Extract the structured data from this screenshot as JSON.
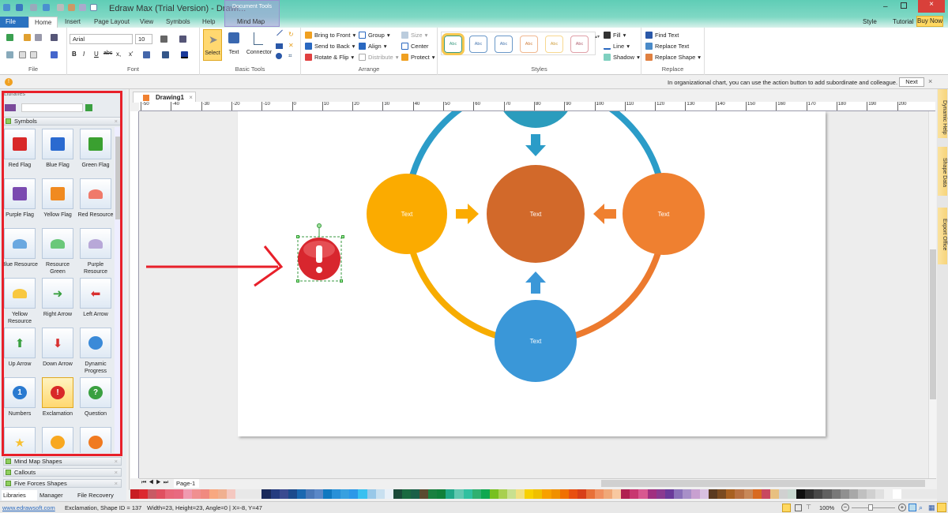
{
  "app": {
    "title": "Edraw Max (Trial Version) - Drawi...",
    "context_tab_group": "Document Tools",
    "buy_now": "Buy Now",
    "style": "Style",
    "tutorial": "Tutorial"
  },
  "tabs": [
    "File",
    "Home",
    "Insert",
    "Page Layout",
    "View",
    "Symbols",
    "Help",
    "Mind Map"
  ],
  "ribbon": {
    "file_group": "File",
    "font": {
      "group": "Font",
      "family": "Arial",
      "size": "10",
      "bold": "B",
      "italic": "I",
      "underline": "U",
      "strike": "abc",
      "sub": "x,",
      "sup": "x'"
    },
    "basic_tools": {
      "group": "Basic Tools",
      "select": "Select",
      "text": "Text",
      "connector": "Connector"
    },
    "arrange": {
      "group": "Arrange",
      "bring_front": "Bring to Front",
      "send_back": "Send to Back",
      "rotate_flip": "Rotate & Flip",
      "group_btn": "Group",
      "align": "Align",
      "distribute": "Distribute",
      "size": "Size",
      "center": "Center",
      "protect": "Protect"
    },
    "styles": {
      "group": "Styles",
      "swatch": "Abc",
      "fill": "Fill",
      "line": "Line",
      "shadow": "Shadow"
    },
    "replace": {
      "group": "Replace",
      "find": "Find Text",
      "replace_text": "Replace Text",
      "replace_shape": "Replace Shape"
    }
  },
  "infobar": {
    "message": "In organizational chart, you can use the action button to add subordinate and colleague.",
    "next": "Next"
  },
  "library": {
    "title": "Libraries",
    "sections": [
      "Symbols",
      "Mind Map Shapes",
      "Callouts",
      "Five Forces Shapes"
    ],
    "shapes": [
      {
        "label": "Red Flag",
        "icon": "red-flag"
      },
      {
        "label": "Blue Flag",
        "icon": "blue-flag"
      },
      {
        "label": "Green Flag",
        "icon": "green-flag"
      },
      {
        "label": "Purple Flag",
        "icon": "purple-flag"
      },
      {
        "label": "Yellow Flag",
        "icon": "yellow-flag"
      },
      {
        "label": "Red Resource",
        "icon": "red-resource"
      },
      {
        "label": "Blue Resource",
        "icon": "blue-resource"
      },
      {
        "label": "Resource Green",
        "icon": "green-resource"
      },
      {
        "label": "Purple Resource",
        "icon": "purple-resource"
      },
      {
        "label": "Yellow Resource",
        "icon": "yellow-resource"
      },
      {
        "label": "Right Arrow",
        "icon": "right-arrow"
      },
      {
        "label": "Left Arrow",
        "icon": "left-arrow"
      },
      {
        "label": "Up Arrow",
        "icon": "up-arrow"
      },
      {
        "label": "Down Arrow",
        "icon": "down-arrow"
      },
      {
        "label": "Dynamic Progress",
        "icon": "progress"
      },
      {
        "label": "Numbers",
        "icon": "numbers"
      },
      {
        "label": "Exclamation",
        "icon": "exclamation"
      },
      {
        "label": "Question",
        "icon": "question"
      },
      {
        "label": "",
        "icon": "star"
      },
      {
        "label": "",
        "icon": "bulb"
      },
      {
        "label": "",
        "icon": "bulb-orange"
      }
    ],
    "bottom_tabs": [
      "Libraries",
      "Manager",
      "File Recovery"
    ]
  },
  "document": {
    "tab": "Drawing1",
    "page_tab": "Page-1",
    "ruler_labels": [
      "-50",
      "-40",
      "-30",
      "-20",
      "-10",
      "0",
      "10",
      "20",
      "30",
      "40",
      "50",
      "60",
      "70",
      "80",
      "90",
      "100",
      "110",
      "120",
      "130",
      "140",
      "150",
      "160",
      "170",
      "180",
      "190",
      "200"
    ]
  },
  "diagram": {
    "left": "Text",
    "center": "Text",
    "right": "Text",
    "bottom": "Text"
  },
  "dock": [
    "Dynamic Help",
    "Shape Data",
    "Export Office"
  ],
  "palette": [
    "#c81e24",
    "#dc2830",
    "#c85a64",
    "#e05060",
    "#e8687a",
    "#e86a80",
    "#f09ab0",
    "#f09090",
    "#f08a80",
    "#f8a880",
    "#f0b090",
    "#f4c8c0",
    "#e8e8e8",
    "#e8e8e8",
    "#e8e8e8",
    "#1a2a5a",
    "#243c80",
    "#3a4a90",
    "#1c4a8c",
    "#1a68b0",
    "#4a78b8",
    "#5a88c8",
    "#1078c0",
    "#2890d8",
    "#38a0e0",
    "#2c98e8",
    "#38c0f0",
    "#98c8e8",
    "#c8e0f0",
    "#e8f0f8",
    "#1a4a3a",
    "#1a6a40",
    "#1a6048",
    "#5a4a30",
    "#1a8040",
    "#10803a",
    "#20a888",
    "#60c8b0",
    "#30c0a0",
    "#30b070",
    "#10a850",
    "#78c020",
    "#a8d050",
    "#c8e090",
    "#f0e080",
    "#f8d000",
    "#f0c000",
    "#f8a000",
    "#f09000",
    "#f07000",
    "#e85010",
    "#d84018",
    "#e87038",
    "#f09060",
    "#f0a878",
    "#f8c8a0",
    "#b02050",
    "#c83870",
    "#d85890",
    "#a03080",
    "#8a3a90",
    "#6a3a9a",
    "#8a70b8",
    "#a890c8",
    "#c8a0d0",
    "#d8c0e0",
    "#5a3a20",
    "#7a4a20",
    "#a86020",
    "#b87040",
    "#c88858",
    "#d86a20",
    "#c84860",
    "#e8c080",
    "#d0d0d0",
    "#c8d8d0",
    "#101010",
    "#303030",
    "#484848",
    "#606060",
    "#787878",
    "#909090",
    "#a8a8a8",
    "#c0c0c0",
    "#d0d0d0",
    "#e0e0e0",
    "#f0f0f0",
    "#ffffff",
    "#e8e8e8",
    "#e8e8e8",
    "#e8e8e8",
    "#e8e8e8"
  ],
  "statusbar": {
    "link": "www.edrawsoft.com",
    "shape_info": "Exclamation, Shape ID = 137",
    "geometry": "Width=23, Height=23, Angle=0 | X=-8, Y=47",
    "zoom": "100%"
  }
}
